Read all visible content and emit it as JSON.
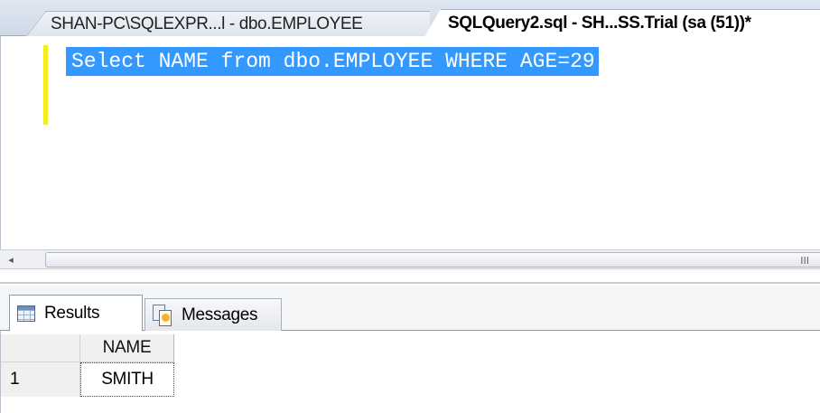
{
  "document_tabs": [
    {
      "title": "SHAN-PC\\SQLEXPR...l - dbo.EMPLOYEE",
      "active": false
    },
    {
      "title": "SQLQuery2.sql - SH...SS.Trial (sa (51))*",
      "active": true
    }
  ],
  "editor": {
    "lines": [
      "Select NAME from dbo.EMPLOYEE WHERE AGE=29"
    ],
    "selected": true
  },
  "scrollbar": {
    "left_arrow": "◂",
    "grip": "III"
  },
  "result_tabs": [
    {
      "label": "Results",
      "icon": "results-grid-icon",
      "active": true
    },
    {
      "label": "Messages",
      "icon": "messages-icon",
      "active": false
    }
  ],
  "results_grid": {
    "columns": [
      "NAME"
    ],
    "rows": [
      {
        "row_number": "1",
        "values": [
          "SMITH"
        ]
      }
    ]
  },
  "colors": {
    "selection": "#3399ff",
    "change_marker": "#f3ec18",
    "tab_strip": "#cfd9e6"
  }
}
